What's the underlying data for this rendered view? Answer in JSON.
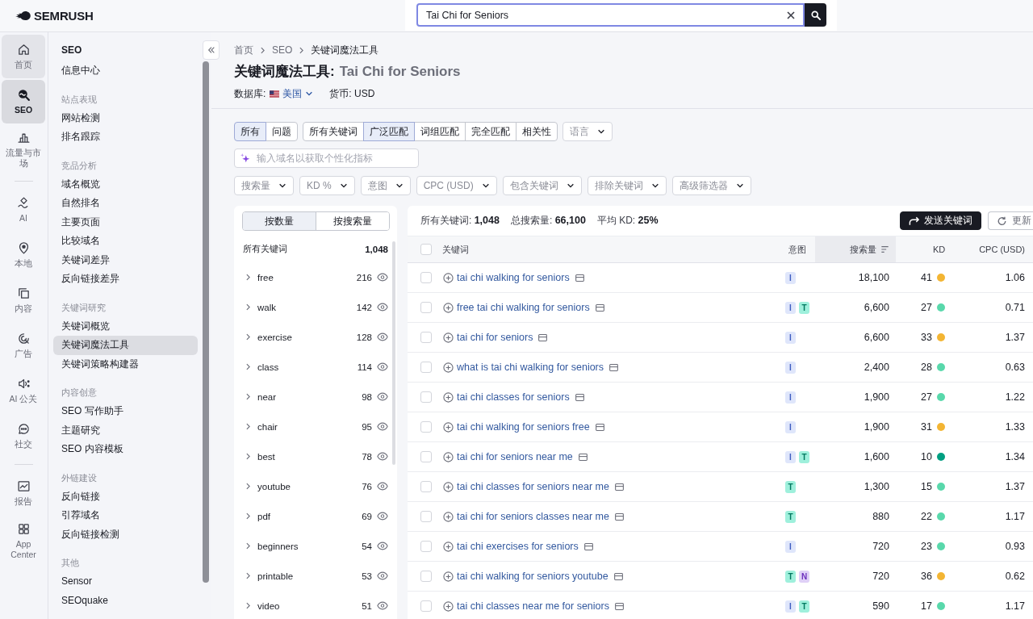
{
  "header": {
    "logo": "SEMRUSH",
    "search": {
      "value": "Tai Chi for Seniors"
    }
  },
  "rail_groups": [
    {
      "items": [
        {
          "label": "首页",
          "selected": false,
          "hovered": true
        },
        {
          "label": "SEO",
          "selected": true,
          "hovered": false
        },
        {
          "label": "流量与市场",
          "selected": false,
          "hovered": false
        }
      ]
    },
    {
      "items": [
        {
          "label": "AI",
          "selected": false,
          "hovered": false
        },
        {
          "label": "本地",
          "selected": false,
          "hovered": false
        },
        {
          "label": "内容",
          "selected": false,
          "hovered": false
        },
        {
          "label": "广告",
          "selected": false,
          "hovered": false
        },
        {
          "label": "AI 公关",
          "selected": false,
          "hovered": false
        },
        {
          "label": "社交",
          "selected": false,
          "hovered": false
        }
      ]
    },
    {
      "items": [
        {
          "label": "报告",
          "selected": false,
          "hovered": false
        },
        {
          "label": "App Center",
          "selected": false,
          "hovered": false
        }
      ]
    }
  ],
  "sidebar": {
    "title": "SEO",
    "items": [
      {
        "label": "信息中心",
        "selected": false
      }
    ],
    "sections": [
      {
        "heading": "站点表现",
        "items": [
          {
            "label": "网站检测",
            "selected": false
          },
          {
            "label": "排名跟踪",
            "selected": false
          }
        ]
      },
      {
        "heading": "竞品分析",
        "items": [
          {
            "label": "域名概览",
            "selected": false
          },
          {
            "label": "自然排名",
            "selected": false
          },
          {
            "label": "主要页面",
            "selected": false
          },
          {
            "label": "比较域名",
            "selected": false
          },
          {
            "label": "关键词差异",
            "selected": false
          },
          {
            "label": "反向链接差异",
            "selected": false
          }
        ]
      },
      {
        "heading": "关键词研究",
        "items": [
          {
            "label": "关键词概览",
            "selected": false
          },
          {
            "label": "关键词魔法工具",
            "selected": true
          },
          {
            "label": "关键词策略构建器",
            "selected": false
          }
        ]
      },
      {
        "heading": "内容创意",
        "items": [
          {
            "label": "SEO 写作助手",
            "selected": false
          },
          {
            "label": "主题研究",
            "selected": false
          },
          {
            "label": "SEO 内容模板",
            "selected": false
          }
        ]
      },
      {
        "heading": "外链建设",
        "items": [
          {
            "label": "反向链接",
            "selected": false
          },
          {
            "label": "引荐域名",
            "selected": false
          },
          {
            "label": "反向链接检测",
            "selected": false
          }
        ]
      },
      {
        "heading": "其他",
        "items": [
          {
            "label": "Sensor",
            "selected": false
          },
          {
            "label": "SEOquake",
            "selected": false
          }
        ]
      }
    ]
  },
  "breadcrumb": [
    "首页",
    "SEO",
    "关键词魔法工具"
  ],
  "title": {
    "tool": "关键词魔法工具:",
    "query": "Tai Chi for Seniors"
  },
  "database": {
    "label": "数据库:",
    "value": "美国",
    "currency": "货币: USD"
  },
  "match_groups": [
    {
      "items": [
        {
          "label": "所有",
          "selected": true
        },
        {
          "label": "问题",
          "selected": false
        }
      ]
    },
    {
      "items": [
        {
          "label": "所有关键词",
          "selected": false
        },
        {
          "label": "广泛匹配",
          "selected": true
        },
        {
          "label": "词组匹配",
          "selected": false
        },
        {
          "label": "完全匹配",
          "selected": false
        },
        {
          "label": "相关性",
          "selected": false
        }
      ]
    }
  ],
  "language": {
    "label": "语言"
  },
  "domain_field": {
    "placeholder": "输入域名以获取个性化指标"
  },
  "filters": [
    "搜索量",
    "KD %",
    "意图",
    "CPC (USD)",
    "包含关键词",
    "排除关键词",
    "高级筛选器"
  ],
  "groups_panel": {
    "toggle": [
      {
        "label": "按数量",
        "selected": true
      },
      {
        "label": "按搜索量",
        "selected": false
      }
    ],
    "total": {
      "label": "所有关键词",
      "count": "1,048"
    },
    "items": [
      {
        "label": "free",
        "count": "216"
      },
      {
        "label": "walk",
        "count": "142"
      },
      {
        "label": "exercise",
        "count": "128"
      },
      {
        "label": "class",
        "count": "114"
      },
      {
        "label": "near",
        "count": "98"
      },
      {
        "label": "chair",
        "count": "95"
      },
      {
        "label": "best",
        "count": "78"
      },
      {
        "label": "youtube",
        "count": "76"
      },
      {
        "label": "pdf",
        "count": "69"
      },
      {
        "label": "beginners",
        "count": "54"
      },
      {
        "label": "printable",
        "count": "53"
      },
      {
        "label": "video",
        "count": "51"
      }
    ]
  },
  "table": {
    "summary": [
      "所有关键词: **1,048**",
      "总搜索量: **66,100**",
      "平均 KD: **25%**"
    ],
    "actions": [
      {
        "label": "发送关键词",
        "kind": "primary"
      },
      {
        "label": "更新",
        "kind": "secondary"
      }
    ],
    "select_all": {
      "checked": false
    },
    "columns": [
      {
        "label": "关键词",
        "sorted": false
      },
      {
        "label": "意图",
        "sorted": false
      },
      {
        "label": "搜索量",
        "sorted": true
      },
      {
        "label": "KD",
        "sorted": false
      },
      {
        "label": "CPC (USD)",
        "sorted": false
      }
    ],
    "rows": [
      {
        "keyword": "tai chi walking for seniors",
        "checked": false,
        "intents": [
          {
            "label": "I",
            "kind": "informational"
          }
        ],
        "volume": "18,100",
        "kd": {
          "value": "41",
          "color": "#f3b533"
        },
        "cpc": "1.06"
      },
      {
        "keyword": "free tai chi walking for seniors",
        "checked": false,
        "intents": [
          {
            "label": "I",
            "kind": "informational"
          },
          {
            "label": "T",
            "kind": "transactional"
          }
        ],
        "volume": "6,600",
        "kd": {
          "value": "27",
          "color": "#59d8ab"
        },
        "cpc": "0.71"
      },
      {
        "keyword": "tai chi for seniors",
        "checked": false,
        "intents": [
          {
            "label": "I",
            "kind": "informational"
          }
        ],
        "volume": "6,600",
        "kd": {
          "value": "33",
          "color": "#f3b533"
        },
        "cpc": "1.37"
      },
      {
        "keyword": "what is tai chi walking for seniors",
        "checked": false,
        "intents": [
          {
            "label": "I",
            "kind": "informational"
          }
        ],
        "volume": "2,400",
        "kd": {
          "value": "28",
          "color": "#59d8ab"
        },
        "cpc": "0.63"
      },
      {
        "keyword": "tai chi classes for seniors",
        "checked": false,
        "intents": [
          {
            "label": "I",
            "kind": "informational"
          }
        ],
        "volume": "1,900",
        "kd": {
          "value": "27",
          "color": "#59d8ab"
        },
        "cpc": "1.22"
      },
      {
        "keyword": "tai chi walking for seniors free",
        "checked": false,
        "intents": [
          {
            "label": "I",
            "kind": "informational"
          }
        ],
        "volume": "1,900",
        "kd": {
          "value": "31",
          "color": "#f3b533"
        },
        "cpc": "1.33"
      },
      {
        "keyword": "tai chi for seniors near me",
        "checked": false,
        "intents": [
          {
            "label": "I",
            "kind": "informational"
          },
          {
            "label": "T",
            "kind": "transactional"
          }
        ],
        "volume": "1,600",
        "kd": {
          "value": "10",
          "color": "#009f81"
        },
        "cpc": "1.34"
      },
      {
        "keyword": "tai chi classes for seniors near me",
        "checked": false,
        "intents": [
          {
            "label": "T",
            "kind": "transactional"
          }
        ],
        "volume": "1,300",
        "kd": {
          "value": "15",
          "color": "#59d8ab"
        },
        "cpc": "1.37"
      },
      {
        "keyword": "tai chi for seniors classes near me",
        "checked": false,
        "intents": [
          {
            "label": "T",
            "kind": "transactional"
          }
        ],
        "volume": "880",
        "kd": {
          "value": "22",
          "color": "#59d8ab"
        },
        "cpc": "1.17"
      },
      {
        "keyword": "tai chi exercises for seniors",
        "checked": false,
        "intents": [
          {
            "label": "I",
            "kind": "informational"
          }
        ],
        "volume": "720",
        "kd": {
          "value": "23",
          "color": "#59d8ab"
        },
        "cpc": "0.93"
      },
      {
        "keyword": "tai chi walking for seniors youtube",
        "checked": false,
        "intents": [
          {
            "label": "T",
            "kind": "transactional"
          },
          {
            "label": "N",
            "kind": "navigational"
          }
        ],
        "volume": "720",
        "kd": {
          "value": "36",
          "color": "#f3b533"
        },
        "cpc": "0.62"
      },
      {
        "keyword": "tai chi classes near me for seniors",
        "checked": false,
        "intents": [
          {
            "label": "I",
            "kind": "informational"
          },
          {
            "label": "T",
            "kind": "transactional"
          }
        ],
        "volume": "590",
        "kd": {
          "value": "17",
          "color": "#59d8ab"
        },
        "cpc": "1.17"
      }
    ]
  }
}
